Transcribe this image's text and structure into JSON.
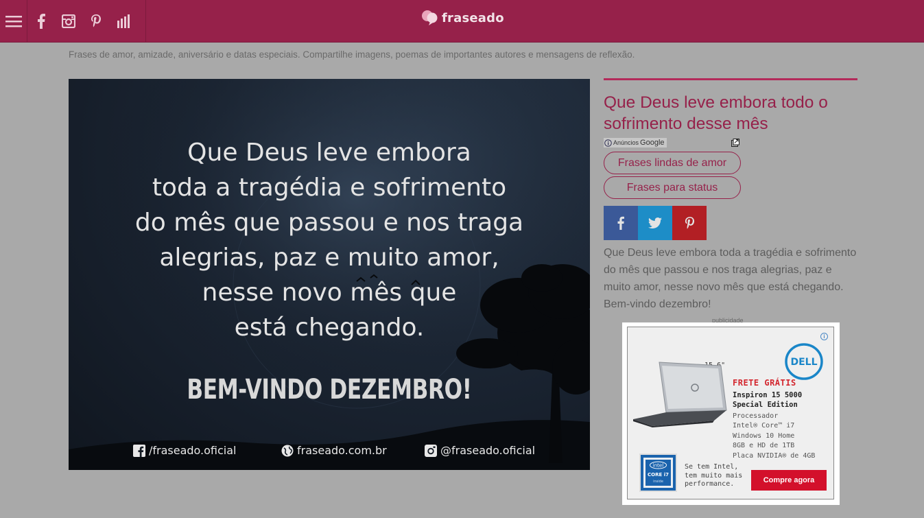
{
  "header": {
    "menu_icon": "hamburger-icon",
    "social_icons": [
      "facebook-icon",
      "instagram-icon",
      "pinterest-icon",
      "signal-bars-icon"
    ],
    "logo_text": "fraseado",
    "brand_color": "#96214a"
  },
  "tagline": "Frases de amor, amizade, aniversário e datas especiais. Compartilhe imagens, poemas de importantes autores e mensagens de reflexão.",
  "hero": {
    "quote_lines": [
      "Que Deus leve embora",
      "toda a tragédia e sofrimento",
      "do mês que passou e nos traga",
      "alegrias, paz e muito amor,",
      "nesse novo mês que",
      "está chegando."
    ],
    "welcome": "BEM-VINDO DEZEMBRO!",
    "footer": {
      "facebook": "/fraseado.oficial",
      "website": "fraseado.com.br",
      "instagram": "@fraseado.oficial"
    }
  },
  "sidebar": {
    "title": "Que Deus leve embora todo o sofrimento desse mês",
    "ads_label_small": "Anúncios",
    "ads_label_brand": "Google",
    "pill_1": "Frases lindas de amor",
    "pill_2": "Frases para status",
    "share": [
      {
        "icon": "facebook-icon",
        "color": "#3b5998"
      },
      {
        "icon": "twitter-icon",
        "color": "#1da1f2"
      },
      {
        "icon": "pinterest-icon",
        "color": "#cb2027"
      }
    ],
    "description": "Que Deus leve embora toda a tragédia e sofrimento do mês que passou e nos traga alegrias, paz e muito amor, nesse novo mês que está chegando. Bem-vindo dezembro!",
    "ad_caption": "publicidade"
  },
  "ad": {
    "brand": "DELL",
    "screen_size": "15,6\"",
    "free_shipping": "FRETE GRÁTIS",
    "model_line1": "Inspiron 15 5000",
    "model_line2": "Special Edition",
    "specs": [
      "Processador",
      "Intel® Core™ i7",
      "Windows 10 Home",
      "8GB e HD de 1TB",
      "Placa NVIDIA® de 4GB"
    ],
    "intel_badge_line1": "intel",
    "intel_badge_line2": "CORE i7",
    "intel_badge_line3": "inside",
    "intel_copy": [
      "Se tem Intel,",
      "tem muito mais",
      "performance."
    ],
    "cta": "Compre agora"
  }
}
